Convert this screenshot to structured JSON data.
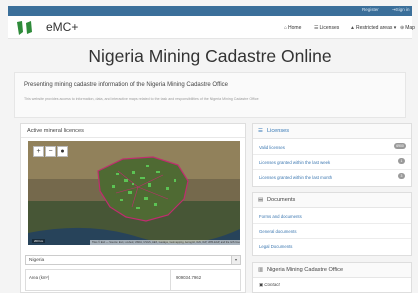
{
  "topbar": {
    "register": "Register",
    "signin": "Sign in"
  },
  "navbar": {
    "brand": "eMC+",
    "home": "Home",
    "licenses": "Licenses",
    "restricted": "Restricted areas",
    "map": "Map"
  },
  "page": {
    "title": "Nigeria Mining Cadastre Online"
  },
  "intro": {
    "heading": "Presenting mining cadastre information of the Nigeria Mining Cadastre Office",
    "subtext": "This website provides access to information, data, and interactive maps related to the task and responsibilities of the Nigeria Mining Cadastre Office"
  },
  "map_panel": {
    "title": "Active mineral licences",
    "zoom_in": "+",
    "zoom_out": "−",
    "locate": "●",
    "attribution": "Tiles © Esri — Source: Esri, i-cubed, USDA, USGS, AEX, GeoEye, Getmapping, Aerogrid, IGN, IGP, UPR-EGP, and the GIS User Community",
    "scale": "200 km",
    "select_value": "Nigeria",
    "table": {
      "label": "Area (km²)",
      "value": "909034.7962"
    }
  },
  "licenses_panel": {
    "title": "Licenses",
    "items": [
      {
        "label": "Valid licenses",
        "badge": "6900"
      },
      {
        "label": "Licenses granted within the last week",
        "badge": "1"
      },
      {
        "label": "Licenses granted within the last month",
        "badge": "3"
      }
    ]
  },
  "documents_panel": {
    "title": "Documents",
    "items": [
      {
        "label": "Forms and documents"
      },
      {
        "label": "General documents"
      },
      {
        "label": "Legal Documents"
      }
    ]
  },
  "office_panel": {
    "title": "Nigeria Mining Cadastre Office",
    "contact": "Contact"
  }
}
